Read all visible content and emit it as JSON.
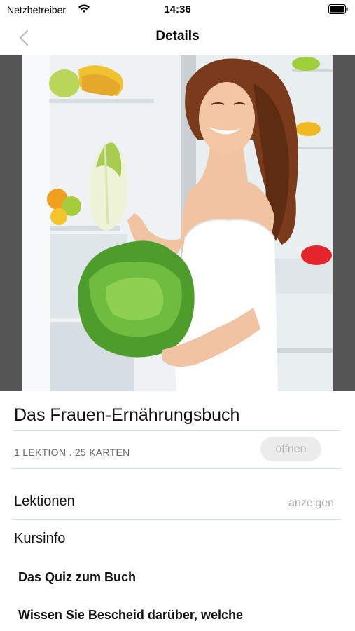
{
  "status_bar": {
    "carrier": "Netzbetreiber",
    "time": "14:36"
  },
  "nav": {
    "title": "Details"
  },
  "course": {
    "title": "Das Frauen-Ernährungsbuch",
    "meta": "1 LEKTION . 25 KARTEN",
    "open_label": "öffnen"
  },
  "sections": {
    "lessons_label": "Lektionen",
    "lessons_action": "anzeigen",
    "info_label": "Kursinfo"
  },
  "description": {
    "line1": "Das Quiz zum Buch",
    "line2": "Wissen Sie Bescheid darüber, welche"
  },
  "colors": {
    "hero_background": "#555556",
    "divider": "#d3e3ee",
    "button_bg": "#ececec",
    "button_text": "#b5b5b5"
  }
}
